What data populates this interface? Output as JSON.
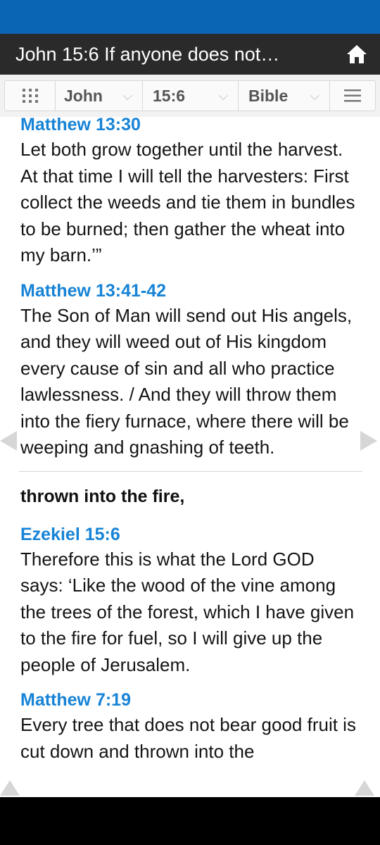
{
  "header": {
    "title": "John 15:6 If anyone does not…",
    "home_icon": "home-icon"
  },
  "nav": {
    "grid_icon": "grid-icon",
    "book": "John",
    "verse": "15:6",
    "version": "Bible",
    "menu_icon": "hamburger-menu-icon"
  },
  "content": {
    "entries_top": [
      {
        "ref": "Matthew 13:30",
        "text": "Let both grow together until the harvest. At that time I will tell the harvesters: First collect the weeds and tie them in bundles to be burned; then gather the wheat into my barn.’”"
      },
      {
        "ref": "Matthew 13:41-42",
        "text": "The Son of Man will send out His angels, and they will weed out of His kingdom every cause of sin and all who practice lawlessness. / And they will throw them into the fiery furnace, where there will be weeping and gnashing of teeth."
      }
    ],
    "section_heading": "thrown into the fire,",
    "entries_bottom": [
      {
        "ref": "Ezekiel 15:6",
        "text": "Therefore this is what the Lord GOD says: ‘Like the wood of the vine among the trees of the forest, which I have given to the fire for fuel, so I will give up the people of Jerusalem."
      },
      {
        "ref": "Matthew 7:19",
        "text": "Every tree that does not bear good fruit is cut down and thrown into the"
      }
    ]
  },
  "colors": {
    "status_bar": "#0a66b4",
    "title_bar": "#2a2a2a",
    "reference_link": "#1783d6"
  }
}
